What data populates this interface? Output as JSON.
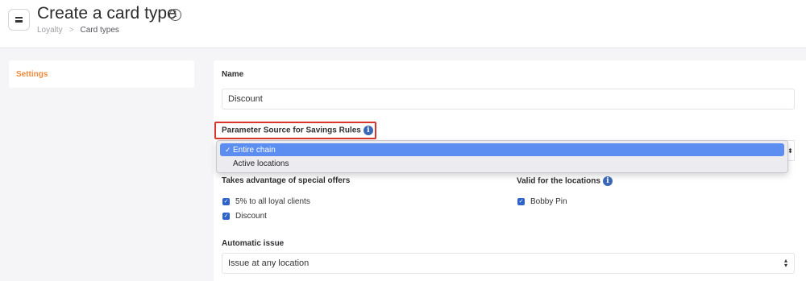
{
  "header": {
    "title": "Create a card type",
    "breadcrumb": [
      "Loyalty",
      "Card types"
    ],
    "breadcrumb_sep": ">"
  },
  "sidebar": {
    "items": [
      {
        "label": "Settings",
        "active": true
      }
    ]
  },
  "form": {
    "name_label": "Name",
    "name_value": "Discount",
    "param_source_label": "Parameter Source for Savings Rules",
    "param_source_options": [
      {
        "label": "Entire chain",
        "selected": true
      },
      {
        "label": "Active locations",
        "selected": false
      }
    ],
    "offers_label": "Takes advantage of special offers",
    "offers": [
      {
        "label": "5% to all loyal clients",
        "checked": true
      },
      {
        "label": "Discount",
        "checked": true
      }
    ],
    "locations_label": "Valid for the locations",
    "locations": [
      {
        "label": "Bobby Pin",
        "checked": true
      }
    ],
    "auto_issue_label": "Automatic issue",
    "auto_issue_value": "Issue at any location"
  },
  "icons": {
    "menu": "menu-icon",
    "info": "info-icon",
    "check": "checkmark-icon",
    "select": "select-arrows-icon"
  },
  "colors": {
    "accent": "#f08a3c",
    "primary": "#2e64c9",
    "highlight": "#d9362b",
    "dropdown_selected": "#5b8ef0"
  }
}
